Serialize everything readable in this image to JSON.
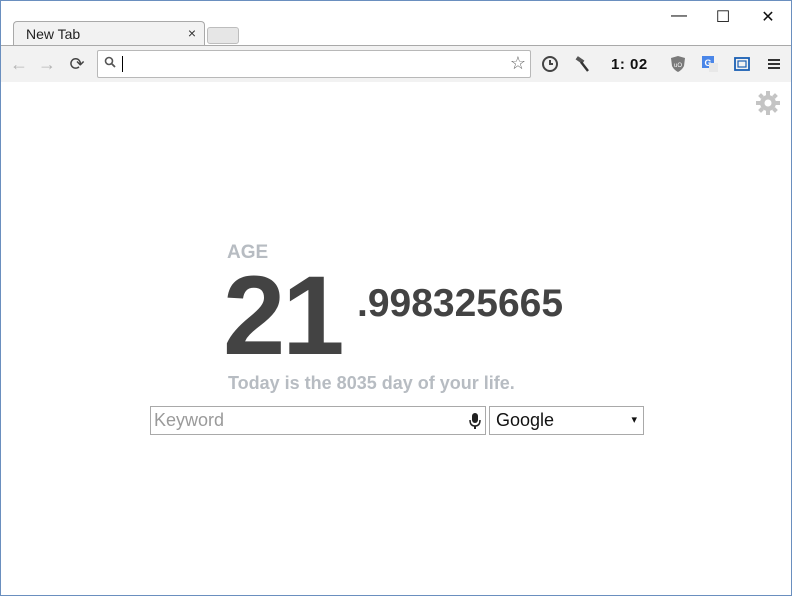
{
  "tab": {
    "title": "New Tab",
    "close": "×"
  },
  "window": {
    "minimize": "—",
    "maximize": "☐",
    "close": "✕"
  },
  "toolbar": {
    "back": "←",
    "forward": "→",
    "reload": "⟳",
    "star": "☆",
    "timer": "1:  02",
    "icons": [
      "back-arrow-icon",
      "forward-arrow-icon",
      "reload-icon",
      "search-icon",
      "star-icon",
      "clock-icon",
      "hammer-icon",
      "ublock-icon",
      "google-translate-icon",
      "screen-capture-icon",
      "menu-icon"
    ]
  },
  "omnibox": {
    "value": ""
  },
  "main": {
    "age_label": "AGE",
    "age_integer": "21",
    "age_decimal": ".998325665",
    "today_text": "Today is the 8035 day of your life.",
    "keyword_placeholder": "Keyword",
    "engine": "Google",
    "engine_arrow": "▾"
  },
  "colors": {
    "age_text": "#434343",
    "muted": "#b7bcc2",
    "frame": "#6a8fbf"
  }
}
